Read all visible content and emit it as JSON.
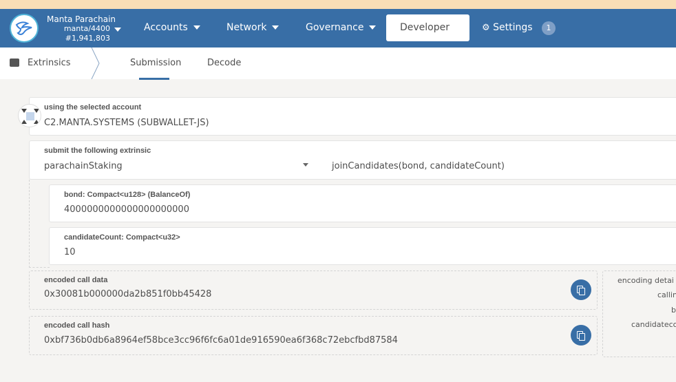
{
  "header": {
    "chain_name": "Manta Parachain",
    "chain_spec": "manta/4400",
    "block": "#1,941,803",
    "menu": [
      "Accounts",
      "Network",
      "Governance",
      "Developer",
      "Settings"
    ],
    "settings_badge": "1"
  },
  "subnav": {
    "section": "Extrinsics",
    "tabs": [
      "Submission",
      "Decode"
    ],
    "active_tab": "Submission"
  },
  "account": {
    "label": "using the selected account",
    "value": "C2.MANTA.SYSTEMS (SUBWALLET-JS)"
  },
  "extrinsic": {
    "label": "submit the following extrinsic",
    "pallet": "parachainStaking",
    "call": "joinCandidates(bond, candidateCount)"
  },
  "params": [
    {
      "label": "bond: Compact<u128> (BalanceOf)",
      "value": "4000000000000000000000"
    },
    {
      "label": "candidateCount: Compact<u32>",
      "value": "10"
    }
  ],
  "encoded_data": {
    "label": "encoded call data",
    "value": "0x30081b000000da2b851f0bb45428"
  },
  "encoded_hash": {
    "label": "encoded call hash",
    "value": "0xbf736b0db6a8964ef58bce3cc96f6fc6a01de916590ea6f368c72ebcfbd87584"
  },
  "encoding_details": {
    "title": "encoding detai",
    "rows": [
      "callin",
      "b",
      "candidateco"
    ]
  },
  "colors": {
    "accent": "#386ea6",
    "banner": "#f9deb6"
  }
}
